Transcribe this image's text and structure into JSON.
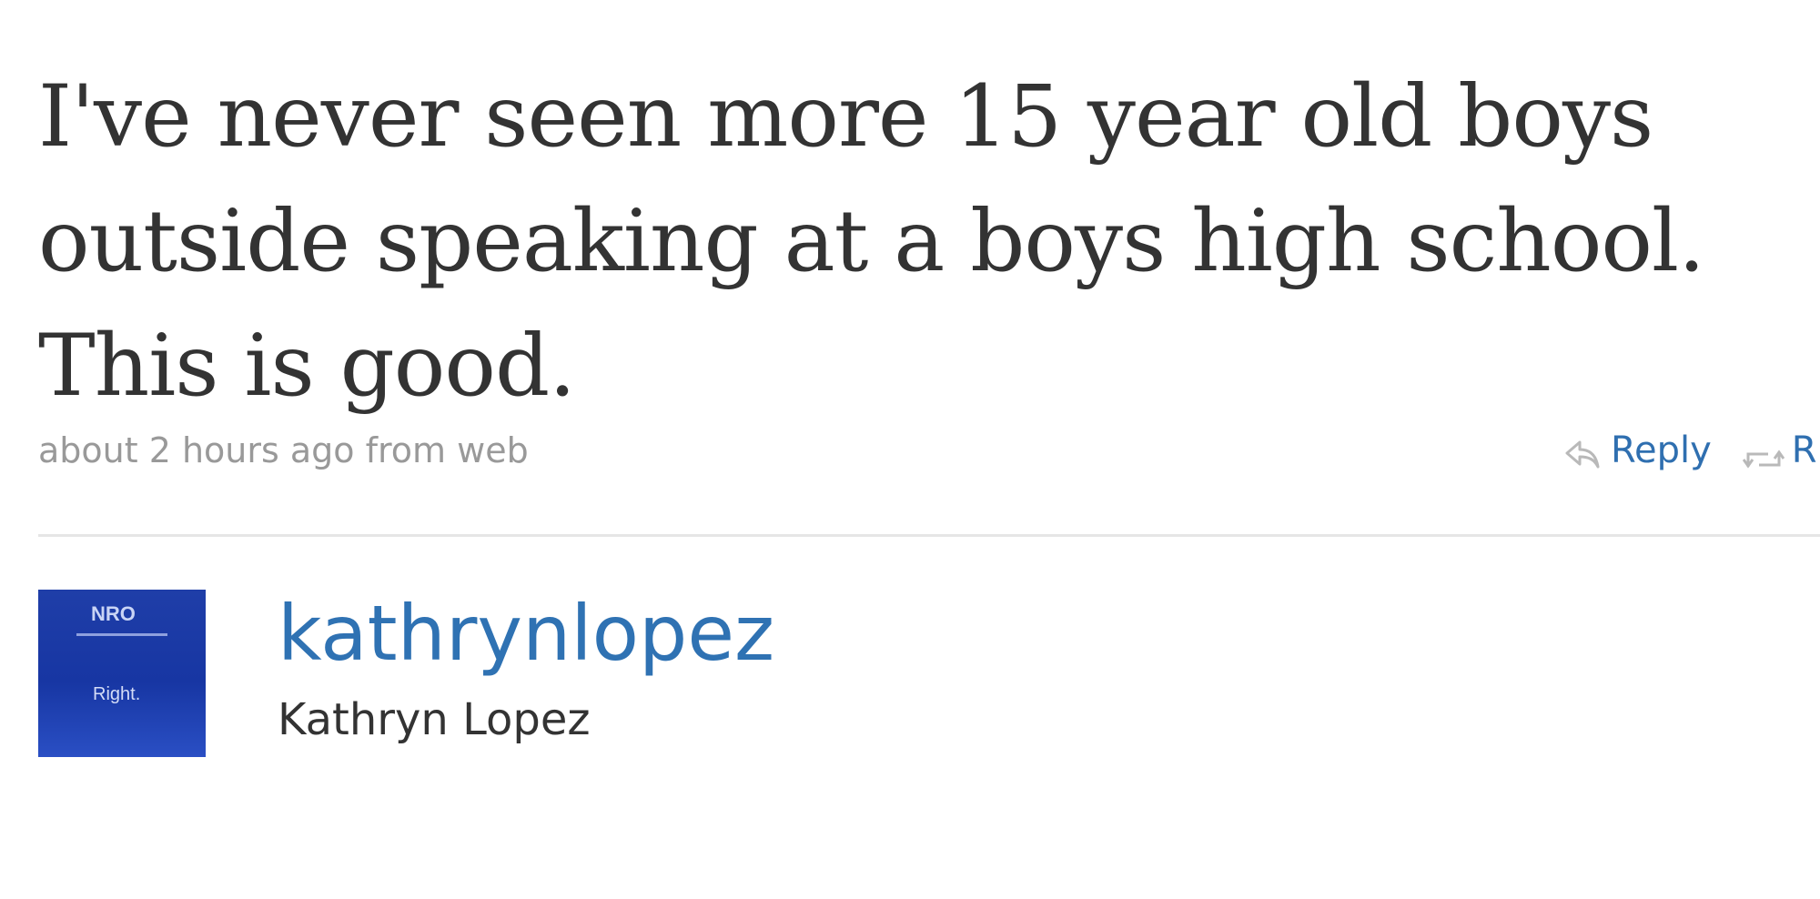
{
  "tweet": {
    "text": "I've never seen more 15 year old boys outside speaking at a boys high school. This is good.",
    "meta": "about 2 hours ago from web"
  },
  "actions": {
    "reply_label": "Reply",
    "retweet_label_partial": "R",
    "link_color": "#2f6fb0"
  },
  "author": {
    "screen_name": "kathrynlopez",
    "full_name": "Kathryn Lopez",
    "avatar": {
      "logo_text": "NRO",
      "caption": "Right.",
      "color": "#1f3ea8"
    }
  },
  "icons": {
    "reply": "reply-arrow-icon",
    "retweet": "retweet-icon"
  }
}
